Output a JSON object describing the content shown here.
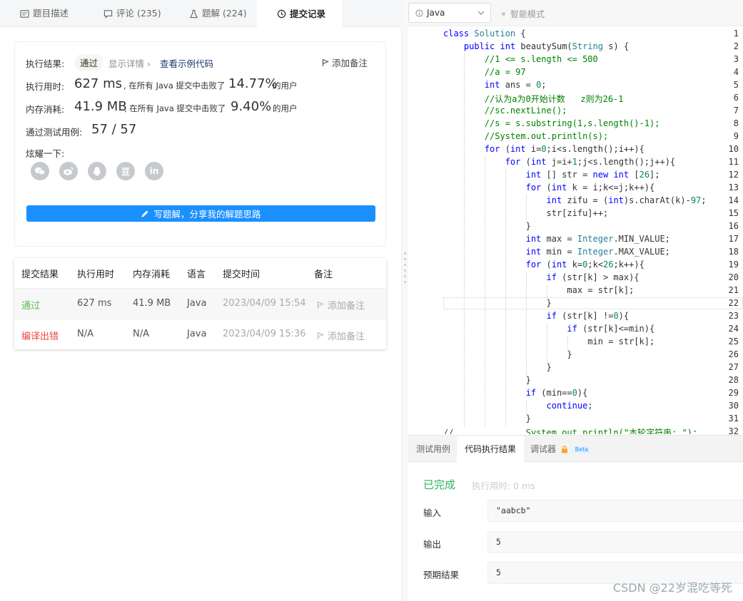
{
  "tabs": [
    {
      "label": "题目描述",
      "icon": "description-icon"
    },
    {
      "label": "评论 (235)",
      "icon": "comment-icon"
    },
    {
      "label": "题解 (224)",
      "icon": "flask-icon"
    },
    {
      "label": "提交记录",
      "icon": "clock-icon"
    }
  ],
  "result": {
    "exec_label": "执行结果:",
    "exec_value": "通过",
    "detail_link": "显示详情 ›",
    "sample_link": "查看示例代码",
    "add_note": "添加备注",
    "time_label": "执行用时:",
    "time_value": "627 ms",
    "time_mid": ", 在所有 Java 提交中击败了",
    "time_pct": "14.77%",
    "time_tail": "的用户",
    "mem_label": "内存消耗:",
    "mem_value": "41.9 MB",
    "mem_mid": ", 在所有 Java 提交中击败了",
    "mem_pct": "9.40%",
    "mem_tail": "的用户",
    "tests_label": "通过测试用例:",
    "tests_value": "57 / 57",
    "share_label": "炫耀一下:",
    "write_btn": "写题解，分享我的解题思路"
  },
  "social": [
    "wechat-icon",
    "weibo-icon",
    "qq-icon",
    "douban-icon",
    "linkedin-icon"
  ],
  "social_glyphs": {
    "douban": "豆",
    "linkedin": "in"
  },
  "table": {
    "headers": [
      "提交结果",
      "执行用时",
      "内存消耗",
      "语言",
      "提交时间",
      "备注"
    ],
    "rows": [
      {
        "status": "通过",
        "status_color": "#5cb85c",
        "time": "627 ms",
        "mem": "41.9 MB",
        "lang": "Java",
        "date": "2023/04/09 15:54",
        "note": "添加备注"
      },
      {
        "status": "编译出错",
        "status_color": "#ef4743",
        "time": "N/A",
        "mem": "N/A",
        "lang": "Java",
        "date": "2023/04/09 15:36",
        "note": "添加备注"
      }
    ]
  },
  "editor": {
    "language": "Java",
    "smart_mode": "智能模式",
    "lines": [
      "class Solution {",
      "    public int beautySum(String s) {",
      "        //1 <= s.length <= 500",
      "        //a = 97",
      "        int ans = 0;",
      "        //认为a为0开始计数   z则为26-1",
      "        //sc.nextLine();",
      "        //s = s.substring(1,s.length()-1);",
      "        //System.out.println(s);",
      "        for (int i=0;i<s.length();i++){",
      "            for (int j=i+1;j<s.length();j++){",
      "                int [] str = new int [26];",
      "                for (int k = i;k<=j;k++){",
      "                    int zifu = (int)s.charAt(k)-97;",
      "                    str[zifu]++;",
      "                }",
      "                int max = Integer.MIN_VALUE;",
      "                int min = Integer.MAX_VALUE;",
      "                for (int k=0;k<26;k++){",
      "                    if (str[k] > max){",
      "                        max = str[k];",
      "                    }",
      "                    if (str[k] !=0){",
      "                        if (str[k]<=min){",
      "                            min = str[k];",
      "                        }",
      "                    }",
      "                }",
      "                if (min==0){",
      "                    continue;",
      "                }",
      "//              System.out.println(\"本轮字符串: \");"
    ]
  },
  "bottom": {
    "tabs": [
      "测试用例",
      "代码执行结果",
      "调试器"
    ],
    "beta": "Beta",
    "status": "已完成",
    "exec_time": "执行用时: 0 ms",
    "input_label": "输入",
    "input_value": "\"aabcb\"",
    "output_label": "输出",
    "output_value": "5",
    "expected_label": "预期结果",
    "expected_value": "5"
  },
  "watermark": "CSDN @22岁混吃等死",
  "colors": {
    "accent": "#1a90ff",
    "pass": "#5cb85c",
    "error": "#ef4743",
    "done": "#2db55d"
  }
}
